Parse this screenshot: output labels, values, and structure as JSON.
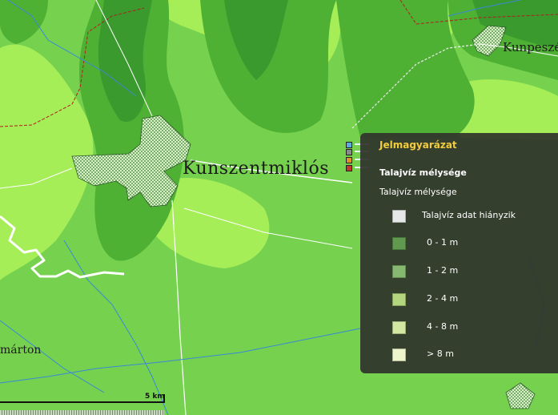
{
  "map": {
    "place_labels": {
      "main": "Kunszentmiklós",
      "northeast": "Kunpeszér",
      "west": "márton"
    },
    "scale_label": "5 km",
    "colors": {
      "background": "#76d24e",
      "light_zone": "#a6ee58",
      "dark_zone": "#4fb134",
      "deep_zone": "#3a9a2e",
      "road": "#ffffff",
      "boundary": "#b02020",
      "river": "#3a88d6"
    }
  },
  "legend": {
    "title": "Jelmagyarázat",
    "layer_name": "Talajvíz mélysége",
    "subtitle": "Talajvíz mélysége",
    "entries": [
      {
        "label": "Talajvíz adat hiányzik",
        "color": "#e6e8e8"
      },
      {
        "label": "0 - 1 m",
        "color": "#5f9a4e"
      },
      {
        "label": "1 - 2 m",
        "color": "#86b96f"
      },
      {
        "label": "2 - 4 m",
        "color": "#b2d57d"
      },
      {
        "label": "4 - 8 m",
        "color": "#d3e8a0"
      },
      {
        "label": "> 8 m",
        "color": "#eef5cd"
      }
    ]
  },
  "layer_control": {
    "icons": [
      "layer-dot-blue",
      "layer-dot-gray",
      "layer-dot-orange",
      "layer-dot-red"
    ]
  }
}
